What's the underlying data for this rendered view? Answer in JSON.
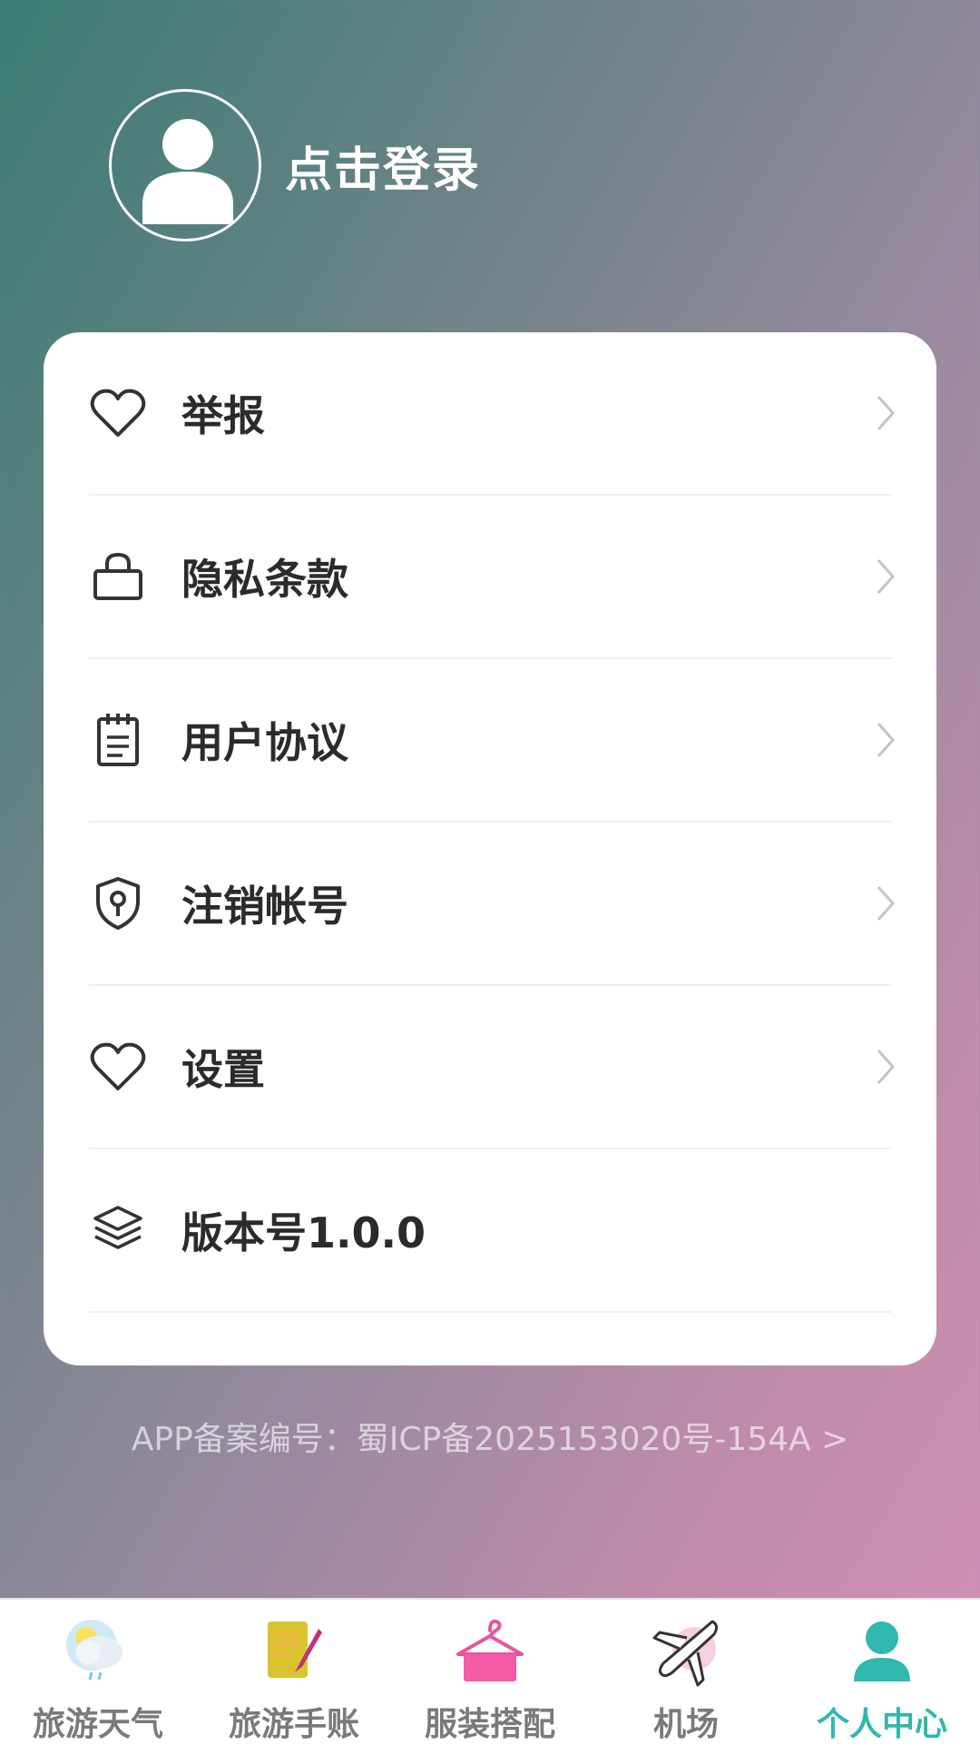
{
  "header": {
    "login_label": "点击登录"
  },
  "menu": [
    {
      "label": "举报",
      "icon": "heart-icon"
    },
    {
      "label": "隐私条款",
      "icon": "lock-icon"
    },
    {
      "label": "用户协议",
      "icon": "notepad-icon"
    },
    {
      "label": "注销帐号",
      "icon": "shield-key-icon"
    },
    {
      "label": "设置",
      "icon": "heart-icon"
    },
    {
      "label": "版本号1.0.0",
      "icon": "layers-icon"
    }
  ],
  "footer": {
    "icp": "APP备案编号：蜀ICP备2025153020号-154A >"
  },
  "tabs": [
    {
      "label": "旅游天气",
      "icon": "weather-icon"
    },
    {
      "label": "旅游手账",
      "icon": "notebook-icon"
    },
    {
      "label": "服装搭配",
      "icon": "clothes-hanger-icon"
    },
    {
      "label": "机场",
      "icon": "airplane-icon"
    },
    {
      "label": "个人中心",
      "icon": "person-icon",
      "active": true
    }
  ],
  "colors": {
    "accent": "#2fb8ad",
    "text": "#2b2b2b"
  }
}
